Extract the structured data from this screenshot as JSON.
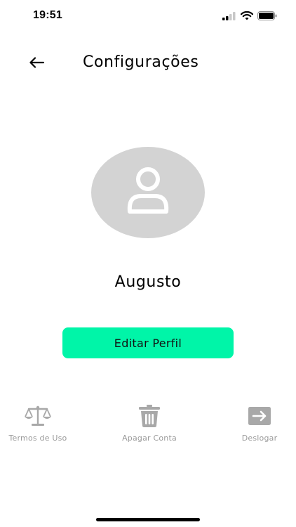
{
  "status_bar": {
    "time": "19:51",
    "icons": [
      "cellular-signal-icon",
      "wifi-icon",
      "battery-icon"
    ]
  },
  "header": {
    "back_icon": "arrow-left-icon",
    "title": "Configurações"
  },
  "profile": {
    "avatar_icon": "user-placeholder-icon",
    "name": "Augusto",
    "edit_button_label": "Editar Perfil"
  },
  "actions": [
    {
      "icon": "scale-icon",
      "label": "Termos de Uso"
    },
    {
      "icon": "trash-icon",
      "label": "Apagar Conta"
    },
    {
      "icon": "logout-arrow-icon",
      "label": "Deslogar"
    }
  ],
  "colors": {
    "accent": "#00f5a8",
    "avatar_bg": "#d3d3d3",
    "muted_icon": "#a8a8a8",
    "muted_text": "#9a9a9a"
  }
}
